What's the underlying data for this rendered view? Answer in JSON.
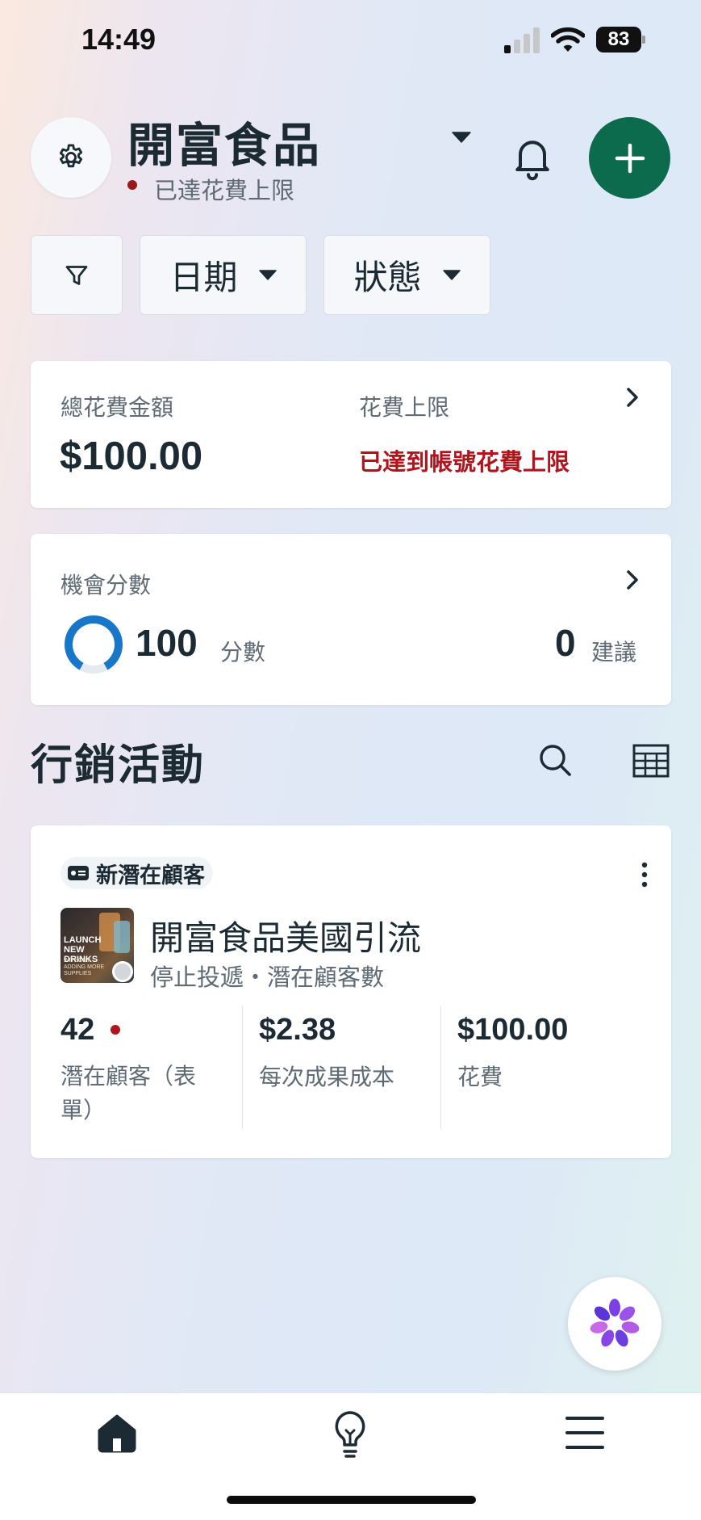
{
  "status_bar": {
    "time": "14:49",
    "battery": "83"
  },
  "header": {
    "account_name": "開富食品",
    "account_status": "已達花費上限"
  },
  "filters": {
    "date_label": "日期",
    "status_label": "狀態"
  },
  "spend_card": {
    "total_label": "總花費金額",
    "total_value": "$100.00",
    "limit_label": "花費上限",
    "limit_value": "已達到帳號花費上限"
  },
  "opportunity_card": {
    "title": "機會分數",
    "score": "100",
    "score_unit": "分數",
    "score_fraction": 1.0,
    "recommendations": "0",
    "recommendations_unit": "建議"
  },
  "campaigns": {
    "section_title": "行銷活動",
    "items": [
      {
        "objective": "新潛在顧客",
        "name": "開富食品美國引流",
        "status": "停止投遞・潛在顧客數",
        "thumbnail_text": "LAUNCH NEW DRINKS",
        "thumbnail_subtext": "WITHOUT ADDING MORE SUPPLIES",
        "metrics": [
          {
            "value": "42",
            "label": "潛在顧客（表單）"
          },
          {
            "value": "$2.38",
            "label": "每次成果成本"
          },
          {
            "value": "$100.00",
            "label": "花費"
          }
        ]
      }
    ]
  },
  "colors": {
    "primary_green": "#0c6b4c",
    "alert_red": "#b0141c",
    "progress_blue": "#1877c9",
    "text_dark": "#1c2b33"
  },
  "icons": {
    "settings": "gear-icon",
    "notifications": "bell-icon",
    "add": "plus-icon",
    "filter": "funnel-icon",
    "search": "search-icon",
    "table": "table-icon",
    "more": "kebab-icon",
    "nav_home": "home-icon",
    "nav_ideas": "lightbulb-icon",
    "nav_menu": "hamburger-icon",
    "ai_assistant": "flower-icon"
  }
}
